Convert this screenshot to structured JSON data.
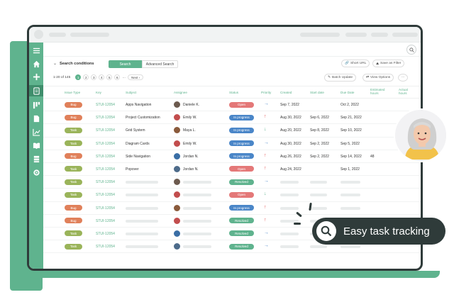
{
  "toolbar": {
    "search_conditions": "Search conditions",
    "search_tab": "Search",
    "advanced_search_tab": "Advanced Search",
    "short_url": "Short URL",
    "save_as_filter": "Save as Filter",
    "batch_update": "Batch Update",
    "view_options": "View Options",
    "more": "···"
  },
  "pager": {
    "range": "1-20 of 145",
    "pages": [
      "1",
      "2",
      "3",
      "4",
      "5",
      "6"
    ],
    "ellipsis": "…",
    "next": "Next"
  },
  "columns": {
    "issue_type": "Issue Type",
    "key": "Key",
    "subject": "Subject",
    "assignee": "Assignee",
    "status": "Status",
    "priority": "Priority",
    "created": "Created",
    "start_date": "Start date",
    "due_date": "Due Date",
    "estimated_hours": "Estimated hours",
    "actual_hours": "Actual hours"
  },
  "rows": [
    {
      "type": "Bug",
      "key": "STUI-12054",
      "subject": "Apps Navigation",
      "assignee": "Daniele K.",
      "status": "Open",
      "priority": "normal",
      "created": "Sep 7, 2022",
      "start": "",
      "due": "Oct 2, 2022",
      "est": "",
      "act": ""
    },
    {
      "type": "Bug",
      "key": "STUI-12054",
      "subject": "Project Customization",
      "assignee": "Emily W.",
      "status": "In progress",
      "priority": "high",
      "created": "Aug 30, 2022",
      "start": "Sep 6, 2022",
      "due": "Sep 21, 2022",
      "est": "",
      "act": ""
    },
    {
      "type": "Task",
      "key": "STUI-12054",
      "subject": "Grid System",
      "assignee": "Maya L.",
      "status": "In progress",
      "priority": "low",
      "created": "Aug 20, 2022",
      "start": "Sep 8, 2022",
      "due": "Sep 10, 2022",
      "est": "",
      "act": ""
    },
    {
      "type": "Task",
      "key": "STUI-12054",
      "subject": "Diagram Cards",
      "assignee": "Emily W.",
      "status": "In progress",
      "priority": "normal",
      "created": "Aug 30, 2022",
      "start": "Sep 2, 2022",
      "due": "Sep 5, 2022",
      "est": "",
      "act": ""
    },
    {
      "type": "Bug",
      "key": "STUI-12054",
      "subject": "Side Navigation",
      "assignee": "Jordan N.",
      "status": "In progress",
      "priority": "high",
      "created": "Aug 26, 2022",
      "start": "Sep 2, 2022",
      "due": "Sep 14, 2022",
      "est": "48",
      "act": ""
    },
    {
      "type": "Task",
      "key": "STUI-12054",
      "subject": "Popover",
      "assignee": "Jordan N.",
      "status": "Open",
      "priority": "high",
      "created": "Aug 24, 2022",
      "start": "",
      "due": "Sep 1, 2022",
      "est": "",
      "act": ""
    },
    {
      "type": "Task",
      "key": "STUI-12054",
      "subject": "",
      "assignee": "",
      "status": "Resolved",
      "priority": "normal",
      "created": "",
      "start": "",
      "due": "",
      "est": "",
      "act": ""
    },
    {
      "type": "Task",
      "key": "STUI-12054",
      "subject": "",
      "assignee": "",
      "status": "Open",
      "priority": "low",
      "created": "",
      "start": "",
      "due": "",
      "est": "",
      "act": ""
    },
    {
      "type": "Bug",
      "key": "STUI-12054",
      "subject": "",
      "assignee": "",
      "status": "In progress",
      "priority": "high",
      "created": "",
      "start": "",
      "due": "",
      "est": "",
      "act": ""
    },
    {
      "type": "Bug",
      "key": "STUI-12054",
      "subject": "",
      "assignee": "",
      "status": "Resolved",
      "priority": "high",
      "created": "",
      "start": "",
      "due": "",
      "est": "",
      "act": ""
    },
    {
      "type": "Task",
      "key": "STUI-12054",
      "subject": "",
      "assignee": "",
      "status": "Resolved",
      "priority": "normal",
      "created": "",
      "start": "",
      "due": "",
      "est": "",
      "act": ""
    },
    {
      "type": "Task",
      "key": "STUI-12054",
      "subject": "",
      "assignee": "",
      "status": "Resolved",
      "priority": "normal",
      "created": "",
      "start": "",
      "due": "",
      "est": "",
      "act": ""
    }
  ],
  "callout": {
    "text": "Easy task tracking"
  },
  "colors": {
    "brand_green": "#5fb38e",
    "bug": "#e0805a",
    "task": "#9ab45a",
    "open": "#e47878",
    "in_progress": "#4a86c8",
    "resolved": "#5fb38e",
    "priority_high": "#e05555",
    "priority_normal": "#4a86c8",
    "priority_low": "#5fb38e"
  }
}
